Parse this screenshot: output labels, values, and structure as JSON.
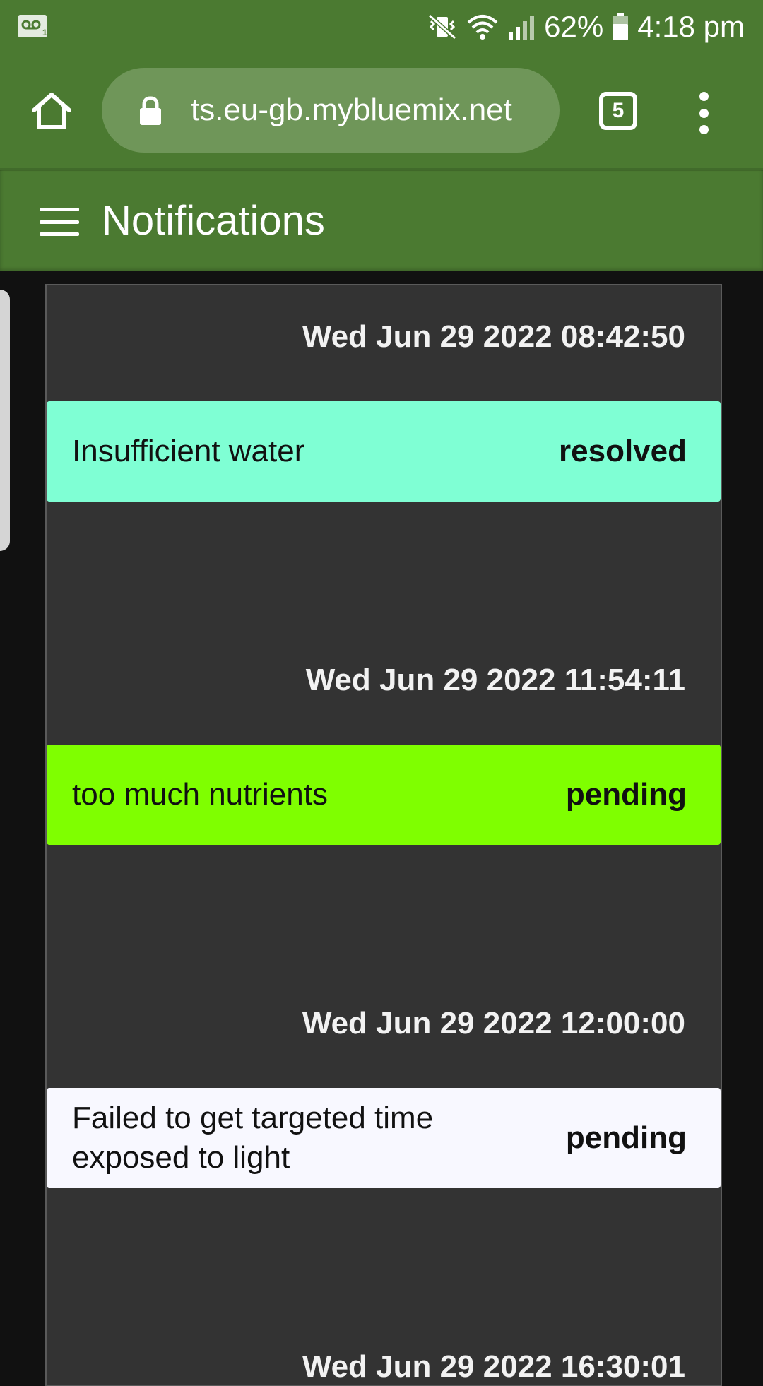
{
  "status_bar": {
    "battery_percent": "62%",
    "time": "4:18 pm",
    "icons": [
      "voicemail-icon",
      "mute-vibrate-icon",
      "wifi-icon",
      "signal-icon",
      "battery-icon"
    ]
  },
  "browser": {
    "url": "ts.eu-gb.mybluemix.net",
    "tab_count": "5",
    "icons": [
      "home-icon",
      "lock-icon",
      "tabs-icon",
      "more-vert-icon"
    ]
  },
  "app_bar": {
    "title": "Notifications",
    "menu_icon": "hamburger-icon"
  },
  "colors": {
    "toolbar": "#4b7a31",
    "url_bar": "#6f9659",
    "panel": "#333333",
    "resolved": "#7fffd4",
    "pending_green": "#7fff00",
    "pending_white": "#f8f8ff"
  },
  "notifications": [
    {
      "date": "Wed Jun 29 2022 08:42:50",
      "message": "Insufficient water",
      "status": "resolved",
      "color": "#7fffd4"
    },
    {
      "date": "Wed Jun 29 2022 11:54:11",
      "message": "too much nutrients",
      "status": "pending",
      "color": "#7fff00"
    },
    {
      "date": "Wed Jun 29 2022 12:00:00",
      "message": "Failed to get targeted time exposed to light",
      "status": "pending",
      "color": "#f8f8ff"
    },
    {
      "date": "Wed Jun 29 2022 16:30:01",
      "message": "",
      "status": "",
      "color": ""
    }
  ]
}
